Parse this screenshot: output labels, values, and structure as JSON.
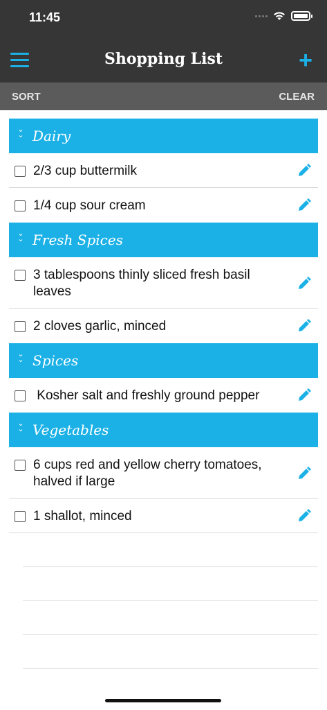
{
  "status_bar": {
    "time": "11:45"
  },
  "nav": {
    "title": "Shopping List",
    "menu_icon": "hamburger-icon",
    "add_label": "+"
  },
  "toolbar": {
    "sort_label": "SORT",
    "clear_label": "CLEAR"
  },
  "colors": {
    "accent": "#1cb1e6",
    "nav_bg": "#363636",
    "toolbar_bg": "#5b5b5b"
  },
  "sections": [
    {
      "title": "Dairy",
      "items": [
        "2/3 cup buttermilk",
        "1/4 cup sour cream"
      ]
    },
    {
      "title": "Fresh Spices",
      "items": [
        "3 tablespoons thinly sliced fresh basil leaves",
        "2 cloves garlic, minced"
      ]
    },
    {
      "title": "Spices",
      "items": [
        " Kosher salt and freshly ground pepper"
      ]
    },
    {
      "title": "Vegetables",
      "items": [
        "6 cups red and yellow cherry tomatoes, halved if large",
        "1 shallot, minced"
      ]
    }
  ]
}
